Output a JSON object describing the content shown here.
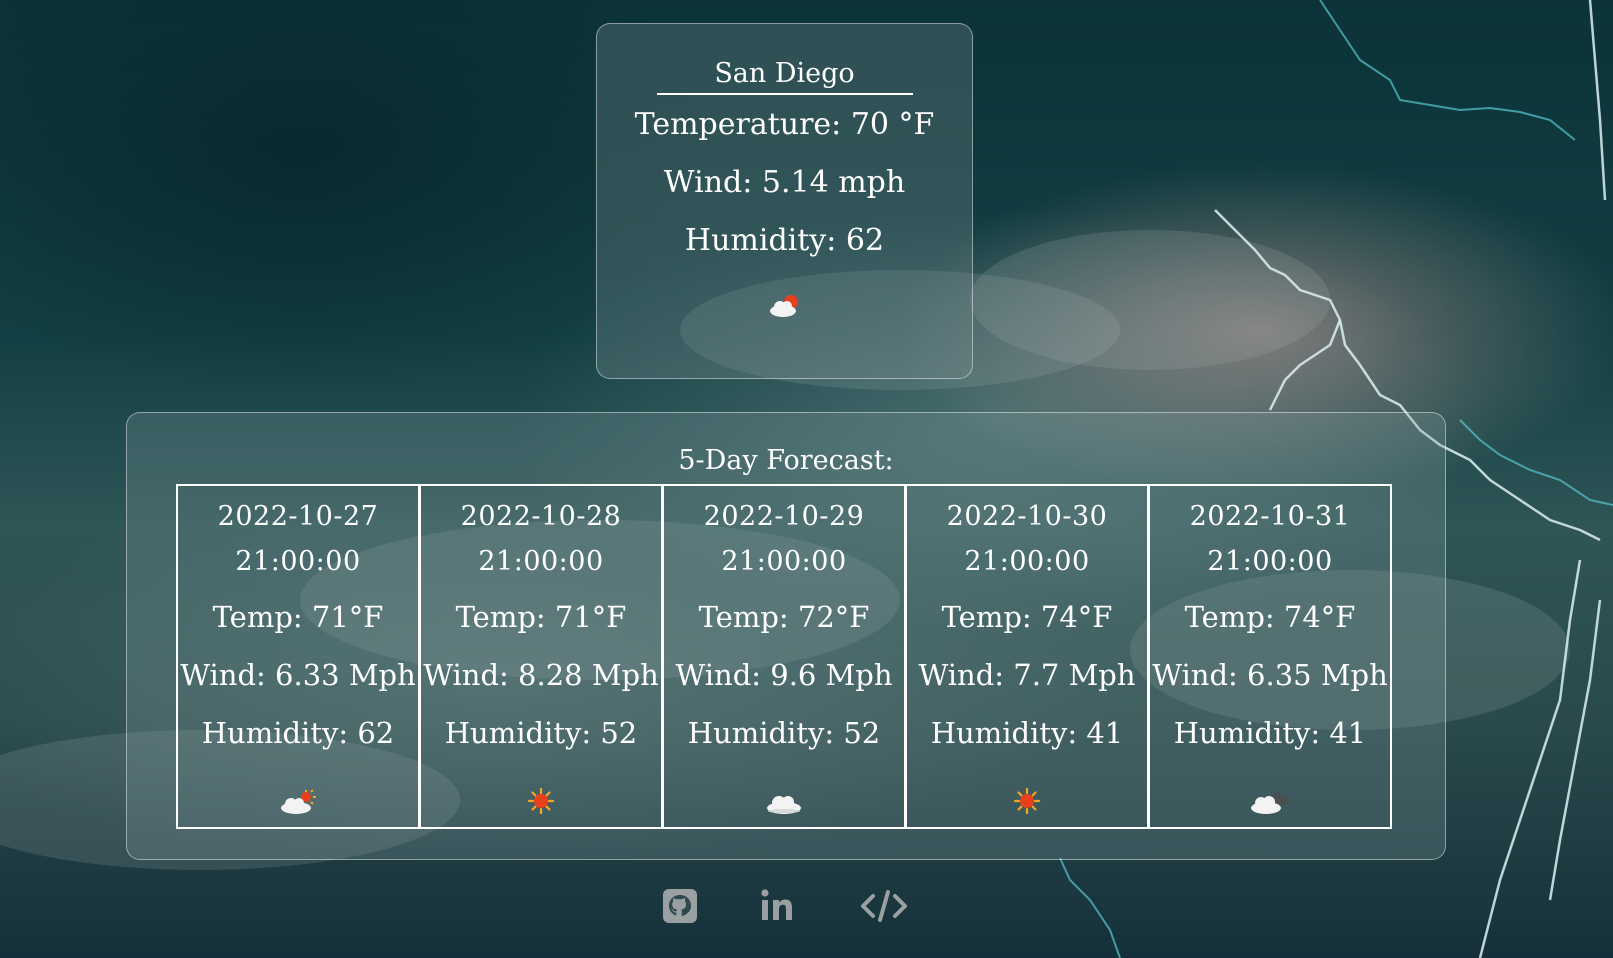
{
  "current": {
    "city": "San Diego",
    "temperature": "Temperature: 70 °F",
    "wind": "Wind: 5.14 mph",
    "humidity": "Humidity: 62",
    "icon": "partly-cloudy-icon"
  },
  "forecast": {
    "title": "5-Day Forecast:",
    "days": [
      {
        "date": "2022-10-27",
        "time": "21:00:00",
        "temp": "Temp: 71°F",
        "wind": "Wind: 6.33 Mph",
        "humidity": "Humidity: 62",
        "icon": "partly-cloudy-icon"
      },
      {
        "date": "2022-10-28",
        "time": "21:00:00",
        "temp": "Temp: 71°F",
        "wind": "Wind: 8.28 Mph",
        "humidity": "Humidity: 52",
        "icon": "sun-icon"
      },
      {
        "date": "2022-10-29",
        "time": "21:00:00",
        "temp": "Temp: 72°F",
        "wind": "Wind: 9.6 Mph",
        "humidity": "Humidity: 52",
        "icon": "cloud-icon"
      },
      {
        "date": "2022-10-30",
        "time": "21:00:00",
        "temp": "Temp: 74°F",
        "wind": "Wind: 7.7 Mph",
        "humidity": "Humidity: 41",
        "icon": "sun-icon"
      },
      {
        "date": "2022-10-31",
        "time": "21:00:00",
        "temp": "Temp: 74°F",
        "wind": "Wind: 6.35 Mph",
        "humidity": "Humidity: 41",
        "icon": "cloudy-night-icon"
      }
    ]
  },
  "footer": {
    "links": [
      {
        "icon": "github-icon"
      },
      {
        "icon": "linkedin-icon"
      },
      {
        "icon": "code-icon"
      }
    ]
  },
  "colors": {
    "text": "#ffffff",
    "sun": "#e8401c",
    "sun_ray": "#f5a623",
    "footer_icon": "#9aa0a2"
  }
}
